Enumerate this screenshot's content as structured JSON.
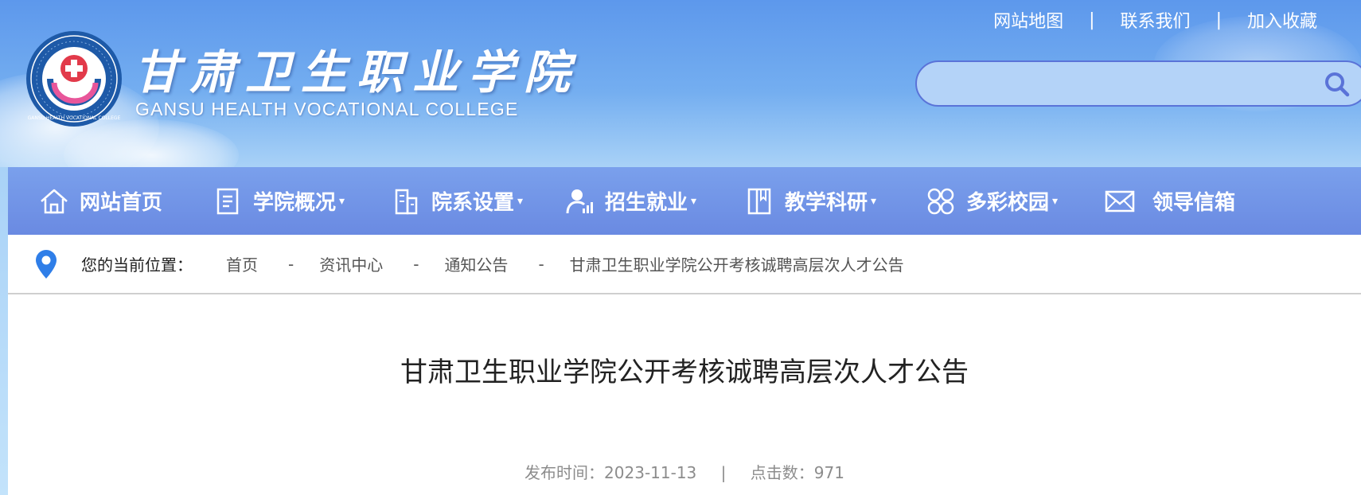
{
  "header": {
    "school_name_cn": "甘肃卫生职业学院",
    "school_name_en": "GANSU HEALTH VOCATIONAL COLLEGE",
    "logo_ring_text": "GANSU HEALTH VOCATIONAL COLLEGE",
    "top_links": [
      "网站地图",
      "联系我们",
      "加入收藏"
    ],
    "top_link_separator": "|",
    "search": {
      "placeholder": "",
      "value": "",
      "icon": "search-icon"
    }
  },
  "nav": {
    "items": [
      {
        "label": "网站首页",
        "icon": "home-icon",
        "has_dropdown": false
      },
      {
        "label": "学院概况",
        "icon": "document-icon",
        "has_dropdown": true
      },
      {
        "label": "院系设置",
        "icon": "building-icon",
        "has_dropdown": true
      },
      {
        "label": "招生就业",
        "icon": "person-chart-icon",
        "has_dropdown": true
      },
      {
        "label": "教学科研",
        "icon": "book-icon",
        "has_dropdown": true
      },
      {
        "label": "多彩校园",
        "icon": "grid-icon",
        "has_dropdown": true
      },
      {
        "label": "领导信箱",
        "icon": "mail-icon",
        "has_dropdown": false
      }
    ],
    "dropdown_caret": "▾"
  },
  "breadcrumb": {
    "label": "您的当前位置：",
    "separator": "-",
    "items": [
      "首页",
      "资讯中心",
      "通知公告"
    ],
    "current": "甘肃卫生职业学院公开考核诚聘高层次人才公告"
  },
  "article": {
    "title": "甘肃卫生职业学院公开考核诚聘高层次人才公告",
    "publish_label": "发布时间：",
    "publish_date": "2023-11-13",
    "meta_separator": "|",
    "clicks_label": "点击数：",
    "clicks": "971"
  },
  "colors": {
    "header_top": "#5d98ec",
    "nav_bg": "#7aa0ec",
    "search_border": "#5a73d8",
    "pin_blue": "#2f7ee8",
    "logo_red": "#e23a4a",
    "logo_pink": "#e8569a"
  }
}
